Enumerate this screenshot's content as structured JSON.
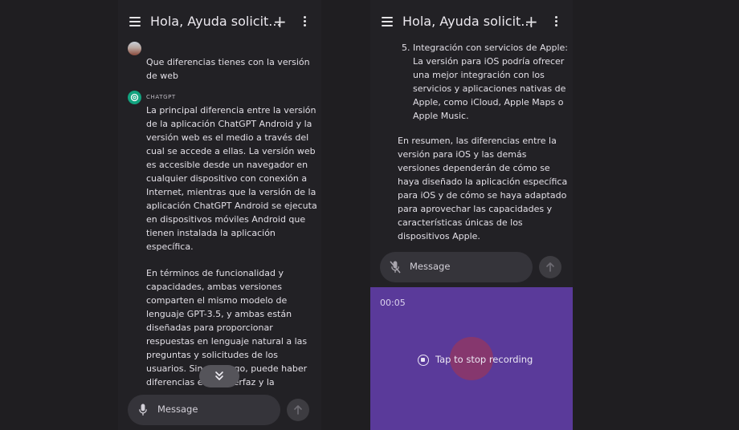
{
  "left": {
    "title": "Hola, Ayuda solicit...",
    "user_message": "Que diferencias tienes con la versión de web",
    "assistant_name": "CHATGPT",
    "assistant_paragraphs": [
      [
        "La principal diferencia entre la versión",
        "de la aplicación ChatGPT Android y la",
        "versión web es el medio a través del",
        "cual se accede a ellas. La versión web",
        "es accesible desde un navegador en",
        "cualquier dispositivo con conexión a",
        "Internet, mientras que la versión de la",
        "aplicación ChatGPT Android se ejecuta",
        "en dispositivos móviles Android que",
        "tienen instalada la aplicación",
        "específica."
      ],
      [
        "En términos de funcionalidad y",
        "capacidades, ambas versiones",
        "comparten el mismo modelo de",
        "lenguaje GPT-3.5, y ambas están",
        "diseñadas para proporcionar",
        "respuestas en lenguaje natural a las",
        "preguntas y solicitudes de los",
        "usuarios. Sin embargo, puede haber",
        "diferencias en la interfaz y la"
      ]
    ],
    "composer_placeholder": "Message"
  },
  "right": {
    "title": "Hola, Ayuda solicit...",
    "list_item_lines": [
      "Integración con servicios de Apple:",
      "La versión para iOS podría ofrecer",
      "una mejor integración con los",
      "servicios y aplicaciones nativas de",
      "Apple, como iCloud, Apple Maps o",
      "Apple Music."
    ],
    "list_number": "5.",
    "summary_lines": [
      "En resumen, las diferencias entre la",
      "versión para iOS y las demás",
      "versiones dependerán de cómo se",
      "haya diseñado la aplicación específica",
      "para iOS y de cómo se haya adaptado",
      "para aprovechar las capacidades y",
      "características únicas de los",
      "dispositivos Apple."
    ],
    "composer_placeholder": "Message",
    "recording_time": "00:05",
    "stop_label": "Tap to stop recording"
  },
  "colors": {
    "background": "#1f1e21",
    "recorder": "#5a3a9a",
    "chatgpt_logo": "#12a37f"
  }
}
